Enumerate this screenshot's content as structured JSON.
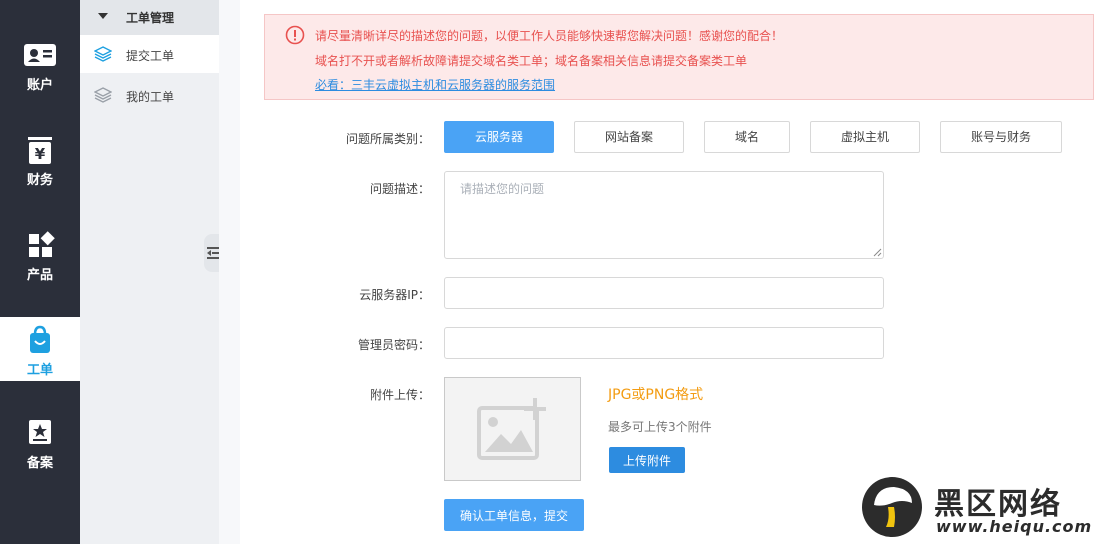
{
  "rail": {
    "items": [
      {
        "label": "账户",
        "icon": "id-card-icon"
      },
      {
        "label": "财务",
        "icon": "yuan-icon"
      },
      {
        "label": "产品",
        "icon": "grid-icon"
      },
      {
        "label": "工单",
        "icon": "shopping-bag-icon",
        "active": true
      },
      {
        "label": "备案",
        "icon": "star-badge-icon"
      }
    ]
  },
  "sidebar": {
    "section": "工单管理",
    "items": [
      {
        "label": "提交工单",
        "active": true
      },
      {
        "label": "我的工单"
      }
    ]
  },
  "alert": {
    "line1": "请尽量清晰详尽的描述您的问题，以便工作人员能够快速帮您解决问题！感谢您的配合！",
    "line2": "域名打不开或者解析故障请提交域名类工单；域名备案相关信息请提交备案类工单",
    "link": "必看：三丰云虚拟主机和云服务器的服务范围"
  },
  "form": {
    "category_label": "问题所属类别：",
    "categories": [
      "云服务器",
      "网站备案",
      "域名",
      "虚拟主机",
      "账号与财务"
    ],
    "desc_label": "问题描述：",
    "desc_placeholder": "请描述您的问题",
    "ip_label": "云服务器IP：",
    "pwd_label": "管理员密码：",
    "attach_label": "附件上传：",
    "format_hint": "JPG或PNG格式",
    "limit_hint": "最多可上传3个附件",
    "upload_button": "上传附件",
    "submit_button": "确认工单信息，提交"
  },
  "watermark": {
    "brand": "黑区网络",
    "url": "www.heiqu.com"
  },
  "colors": {
    "rail_bg": "#2b2f3a",
    "accent": "#4aa3f5",
    "alert_text": "#e8514f",
    "link": "#2d8ce0",
    "hint_orange": "#f39c12"
  }
}
